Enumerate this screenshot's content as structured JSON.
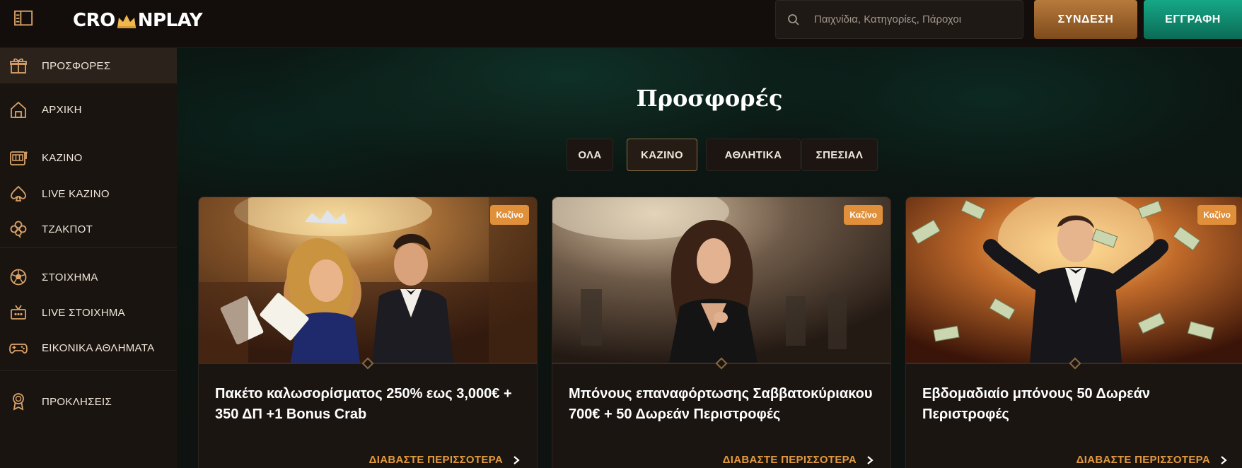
{
  "header": {
    "logo_left": "CRO",
    "logo_right": "NPLAY",
    "search_placeholder": "Παιχνίδια, Κατηγορίες, Πάροχοι",
    "login_label": "ΣΥΝΔΕΣΗ",
    "register_label": "ΕΓΓΡΑΦΗ"
  },
  "sidebar": {
    "items": [
      {
        "label": "ΠΡΟΣΦΟΡΕΣ",
        "icon": "gift-icon",
        "active": true
      },
      {
        "label": "ΑΡΧΙΚΗ",
        "icon": "home-icon"
      },
      {
        "label": "ΚΑΖΙΝΟ",
        "icon": "slot-machine-icon"
      },
      {
        "label": "LIVE ΚΑΖΙΝΟ",
        "icon": "spade-icon"
      },
      {
        "label": "ΤΖΑΚΠΟΤ",
        "icon": "clover-icon"
      },
      {
        "label": "ΣΤΟΙΧΗΜΑ",
        "icon": "soccer-ball-icon"
      },
      {
        "label": "LIVE ΣΤΟΙΧΗΜΑ",
        "icon": "live-tv-icon"
      },
      {
        "label": "ΕΙΚΟΝΙΚΑ ΑΘΛΗΜΑΤΑ",
        "icon": "gamepad-icon"
      },
      {
        "label": "ΠΡΟΚΛΗΣΕΙΣ",
        "icon": "award-icon"
      }
    ]
  },
  "main": {
    "title": "Προσφορές",
    "filters": [
      {
        "label": "ΟΛΑ"
      },
      {
        "label": "ΚΑΖΙΝΟ",
        "active": true
      },
      {
        "label": "ΑΘΛΗΤΙΚΑ"
      },
      {
        "label": "ΣΠΕΣΙΑΛ"
      }
    ],
    "cards": [
      {
        "badge": "Καζίνο",
        "title": "Πακέτο καλωσορίσματος 250% εως 3,000€ + 350 ΔΠ +1 Bonus Crab",
        "link": "ΔΙΑΒΑΣΤΕ ΠΕΡΙΣΣΟΤΕΡΑ"
      },
      {
        "badge": "Καζίνο",
        "title": "Μπόνους επαναφόρτωσης Σαββατοκύριακου 700€ + 50 Δωρεάν Περιστροφές",
        "link": "ΔΙΑΒΑΣΤΕ ΠΕΡΙΣΣΟΤΕΡΑ"
      },
      {
        "badge": "Καζίνο",
        "title": "Εβδομαδιαίο μπόνους 50 Δωρεάν Περιστροφές",
        "link": "ΔΙΑΒΑΣΤΕ ΠΕΡΙΣΣΟΤΕΡΑ"
      }
    ]
  },
  "colors": {
    "accent_orange": "#e39a3e",
    "login_gold": "#b77a3c",
    "register_green": "#16a886"
  }
}
